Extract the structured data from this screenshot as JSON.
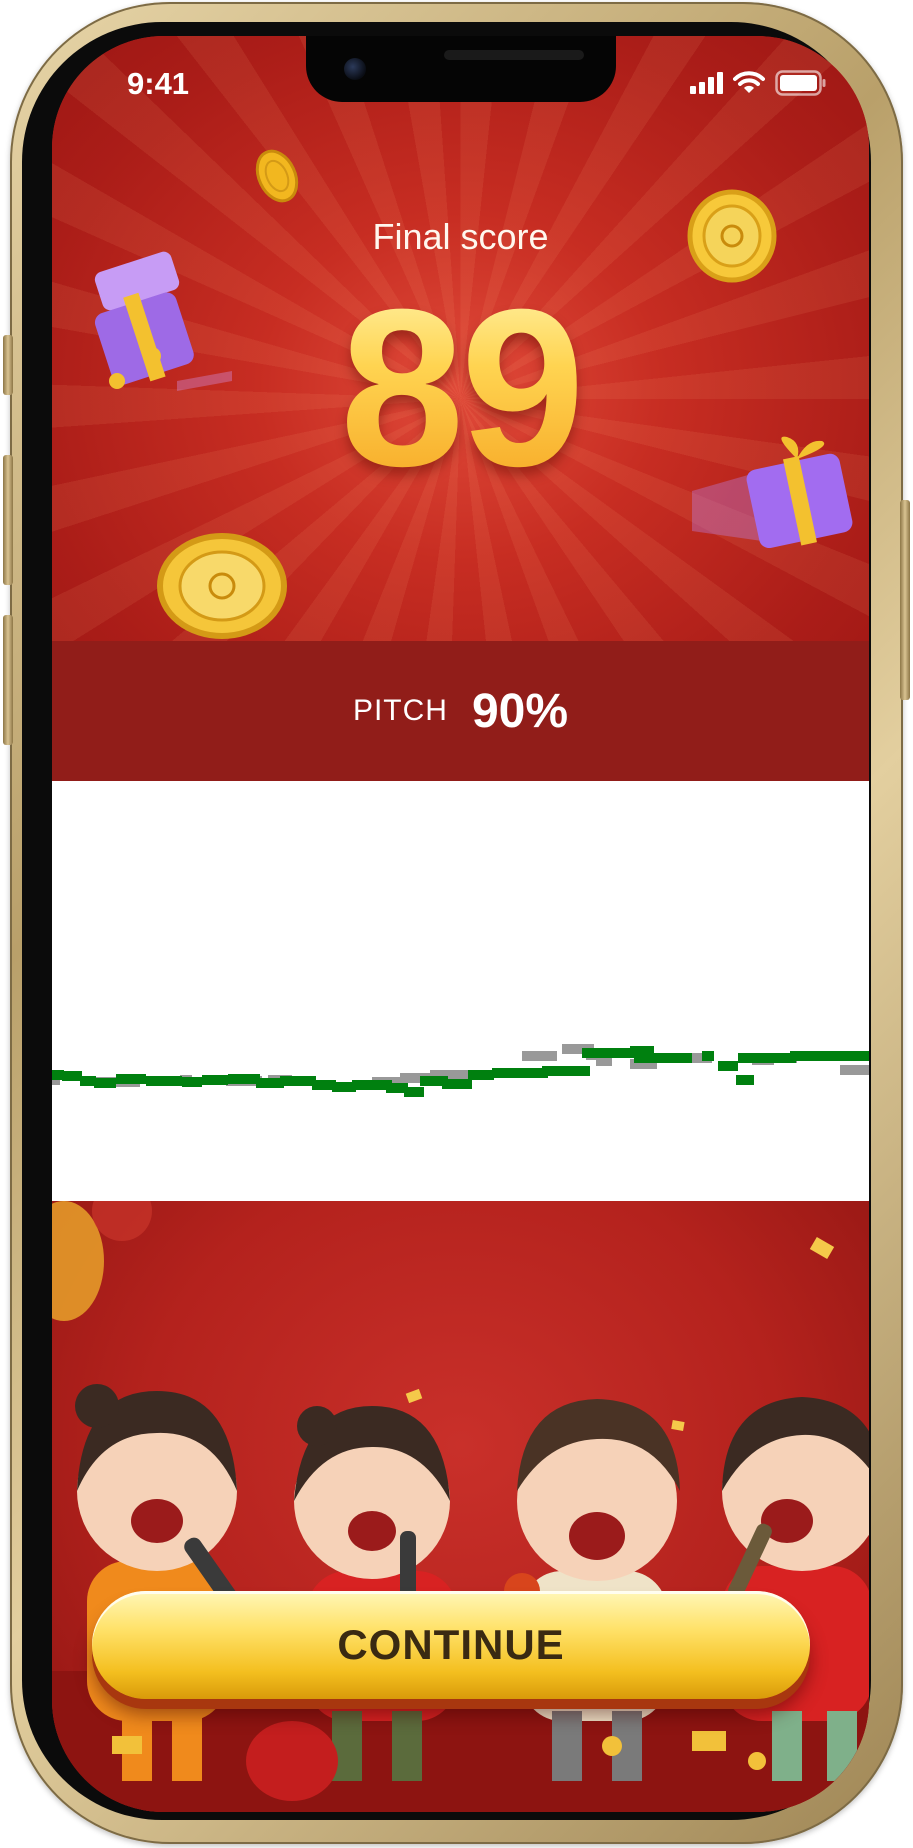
{
  "status_bar": {
    "time": "9:41",
    "icons": [
      "cellular-signal-icon",
      "wifi-icon",
      "battery-icon"
    ]
  },
  "results": {
    "final_score_label": "Final score",
    "score": "89",
    "pitch_label": "PITCH",
    "pitch_value": "90%"
  },
  "chart_data": {
    "type": "scatter",
    "title": "",
    "xlabel": "",
    "ylabel": "",
    "grid": false,
    "legend": "none",
    "series": [
      {
        "role": "target",
        "color": "#999999",
        "segments": [
          [
            0,
            8,
            19
          ],
          [
            42,
            88,
            21
          ],
          [
            128,
            140,
            19
          ],
          [
            174,
            210,
            20
          ],
          [
            216,
            240,
            19
          ],
          [
            320,
            350,
            21
          ],
          [
            348,
            382,
            17
          ],
          [
            378,
            420,
            14
          ],
          [
            470,
            505,
            -5
          ],
          [
            510,
            542,
            -12
          ],
          [
            534,
            552,
            -6
          ],
          [
            544,
            560,
            0
          ],
          [
            578,
            605,
            3
          ],
          [
            636,
            660,
            -3
          ],
          [
            700,
            722,
            -1
          ],
          [
            726,
            745,
            -3
          ],
          [
            788,
            817,
            9
          ]
        ]
      },
      {
        "role": "voice",
        "color": "#00800f",
        "segments": [
          [
            0,
            12,
            14
          ],
          [
            10,
            30,
            15
          ],
          [
            28,
            44,
            20
          ],
          [
            42,
            64,
            22
          ],
          [
            64,
            94,
            18
          ],
          [
            94,
            130,
            20
          ],
          [
            130,
            150,
            21
          ],
          [
            150,
            176,
            19
          ],
          [
            176,
            208,
            18
          ],
          [
            204,
            232,
            22
          ],
          [
            228,
            264,
            20
          ],
          [
            260,
            284,
            24
          ],
          [
            280,
            304,
            26
          ],
          [
            300,
            340,
            24
          ],
          [
            334,
            356,
            27
          ],
          [
            352,
            372,
            31
          ],
          [
            368,
            396,
            20
          ],
          [
            390,
            420,
            23
          ],
          [
            416,
            442,
            14
          ],
          [
            440,
            496,
            12
          ],
          [
            490,
            538,
            10
          ],
          [
            530,
            588,
            -8
          ],
          [
            578,
            602,
            -10
          ],
          [
            582,
            640,
            -3
          ],
          [
            650,
            662,
            -5
          ],
          [
            666,
            686,
            5
          ],
          [
            686,
            744,
            -3
          ],
          [
            738,
            817,
            -5
          ],
          [
            684,
            702,
            19
          ]
        ]
      }
    ]
  },
  "actions": {
    "continue_label": "CONTINUE"
  },
  "theme": {
    "background_red": "#b5221c",
    "band_red": "#911d19",
    "score_gold": "#ffc93d",
    "button_gold": "#f4bf1f",
    "voice_green": "#00800f",
    "target_grey": "#999999"
  }
}
